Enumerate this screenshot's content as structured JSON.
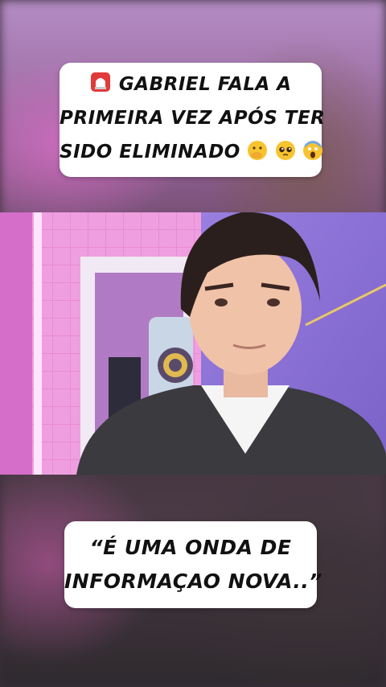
{
  "top_caption": {
    "emoji_start": "siren-emoji",
    "line1": "GABRIEL FALA A",
    "line2": "PRIMEIRA VEZ APÓS TER",
    "line3": "SIDO ELIMINADO",
    "emoji_end": [
      "hand-over-mouth-emoji",
      "pleading-face-emoji",
      "screaming-face-emoji"
    ]
  },
  "bottom_caption": {
    "line1": "“É UMA ONDA DE",
    "line2": "INFORMAÇAO NOVA..”"
  },
  "colors": {
    "caption_bg": "#ffffff",
    "caption_text": "#111111",
    "wall_pink": "#e98ad7",
    "wall_purple": "#8a6fd6"
  }
}
